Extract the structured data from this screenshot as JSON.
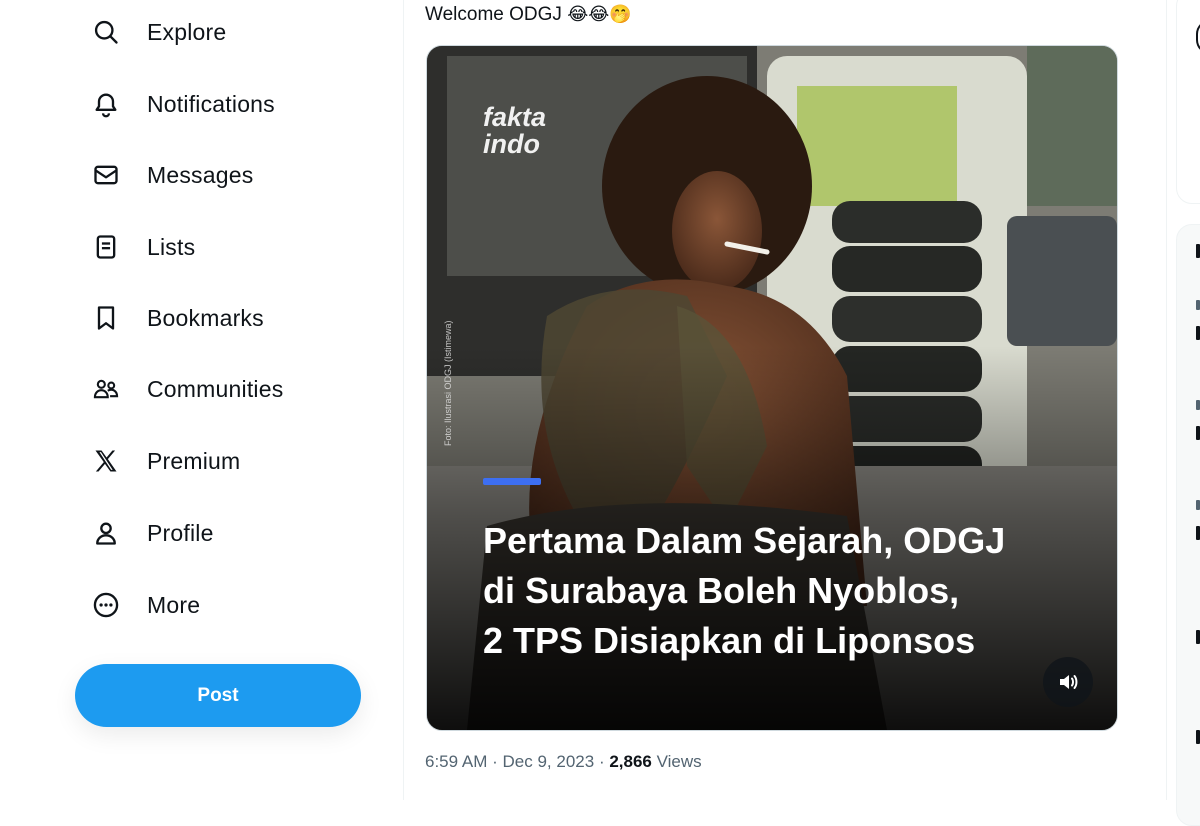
{
  "sidebar": {
    "items": [
      {
        "label": "Explore",
        "icon": "search-icon"
      },
      {
        "label": "Notifications",
        "icon": "bell-icon"
      },
      {
        "label": "Messages",
        "icon": "envelope-icon"
      },
      {
        "label": "Lists",
        "icon": "list-icon"
      },
      {
        "label": "Bookmarks",
        "icon": "bookmark-icon"
      },
      {
        "label": "Communities",
        "icon": "communities-icon"
      },
      {
        "label": "Premium",
        "icon": "x-logo-icon"
      },
      {
        "label": "Profile",
        "icon": "person-icon"
      },
      {
        "label": "More",
        "icon": "more-circle-icon"
      }
    ],
    "post_label": "Post",
    "accent_color": "#1d9bf0"
  },
  "tweet": {
    "text": "Welcome ODGJ",
    "emojis": "😂😂🤭",
    "media": {
      "brand_line1": "fakta",
      "brand_line2": "indo",
      "photo_credit": "Foto: Ilustrasi ODGJ (Istimewa)",
      "headline_line1": "Pertama Dalam Sejarah, ODGJ",
      "headline_line2": "di Surabaya Boleh Nyoblos,",
      "headline_line3": "2 TPS Disiapkan di Liponsos",
      "accent_color": "#3d6ff2",
      "sound_icon": "speaker-icon"
    },
    "time": "6:59 AM",
    "separator": "·",
    "date": "Dec 9, 2023",
    "views_count": "2,866",
    "views_label": "Views"
  }
}
